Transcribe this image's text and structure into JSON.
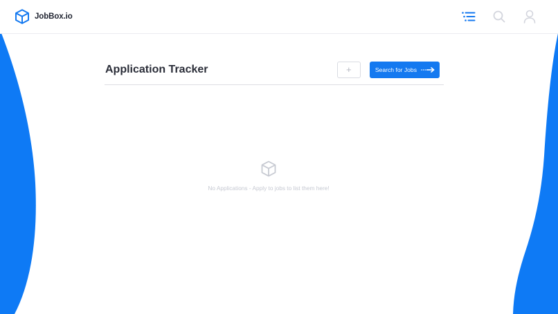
{
  "navbar": {
    "brand_name": "JobBox.io",
    "logo_icon": "cube-icon",
    "actions": [
      {
        "name": "menu",
        "icon": "menu-lines-icon",
        "active": true
      },
      {
        "name": "search",
        "icon": "search-icon",
        "active": false
      },
      {
        "name": "account",
        "icon": "user-icon",
        "active": false
      }
    ]
  },
  "main": {
    "title": "Application Tracker",
    "add_label": "+",
    "search_jobs_label": "Search for Jobs",
    "search_jobs_icon": "arrow-right-icon"
  },
  "empty_state": {
    "icon": "cube-icon",
    "message": "No Applications - Apply to jobs to list them here!"
  },
  "colors": {
    "accent": "#1479f0",
    "wave": "#0e7af5",
    "title": "#2a2d38",
    "muted": "#c6c9d2"
  }
}
